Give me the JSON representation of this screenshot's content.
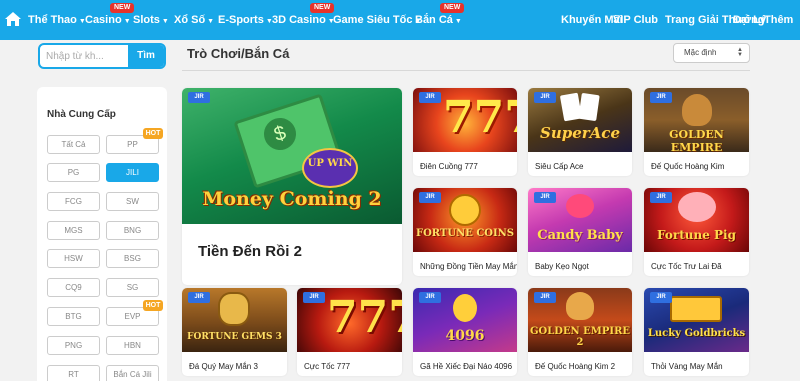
{
  "nav": {
    "items": [
      {
        "label": "Thể Thao",
        "caret": "▼",
        "new": false
      },
      {
        "label": "Casino",
        "caret": "▼",
        "new": true
      },
      {
        "label": "Slots",
        "caret": "▼",
        "new": false
      },
      {
        "label": "Xổ Số",
        "caret": "▼",
        "new": false
      },
      {
        "label": "E-Sports",
        "caret": "▼",
        "new": false
      },
      {
        "label": "3D Casino",
        "caret": "▼",
        "new": true
      },
      {
        "label": "Game Siêu Tốc",
        "caret": "▼",
        "new": false
      },
      {
        "label": "Bắn Cá",
        "caret": "▼",
        "new": true
      }
    ],
    "right_items": [
      "Khuyến Mãi",
      "VIP Club",
      "Trang Giải Thưởng",
      "Đại Lý",
      "Thêm"
    ],
    "new_label": "NEW",
    "accent_color": "#19a8e8"
  },
  "search": {
    "placeholder": "Nhập từ kh...",
    "button_label": "Tìm"
  },
  "providers": {
    "title": "Nhà Cung Cấp",
    "hot_label": "HOT",
    "items": [
      "Tất Cả",
      "PP",
      "PG",
      "JILI",
      "FCG",
      "SW",
      "MGS",
      "BNG",
      "HSW",
      "BSG",
      "CQ9",
      "SG",
      "BTG",
      "EVP",
      "PNG",
      "HBN",
      "RT",
      "Bắn Cá Jili"
    ],
    "active": "JILI"
  },
  "section": {
    "title": "Trò Chơi/Bắn Cá",
    "sort_value": "Mặc định"
  },
  "games": {
    "badge": "JIR",
    "featured": {
      "title": "Tiền Đến Rồi 2",
      "art_text": "Money Coming 2",
      "art_sub": "UP WIN"
    },
    "items": [
      {
        "name": "Điên Cuồng 777",
        "art_text": "777"
      },
      {
        "name": "Siêu Cấp Ace",
        "art_text": "SuperAce"
      },
      {
        "name": "Đế Quốc Hoàng Kim",
        "art_text": "GOLDEN EMPIRE"
      },
      {
        "name": "Những Đồng Tiền May Mắn",
        "art_text": "FORTUNE COINS"
      },
      {
        "name": "Baby Kẹo Ngọt",
        "art_text": "Candy Baby"
      },
      {
        "name": "Cực Tốc Trư Lai Đã",
        "art_text": "Fortune Pig"
      },
      {
        "name": "Đá Quý May Mắn 3",
        "art_text": "FORTUNE GEMS 3"
      },
      {
        "name": "Cực Tốc 777",
        "art_text": "777"
      },
      {
        "name": "Gã Hề Xiếc Đại Náo 4096",
        "art_text": "4096"
      },
      {
        "name": "Đế Quốc Hoàng Kim 2",
        "art_text": "GOLDEN EMPIRE 2"
      },
      {
        "name": "Thỏi Vàng May Mắn",
        "art_text": "Lucky Goldbricks"
      }
    ]
  }
}
